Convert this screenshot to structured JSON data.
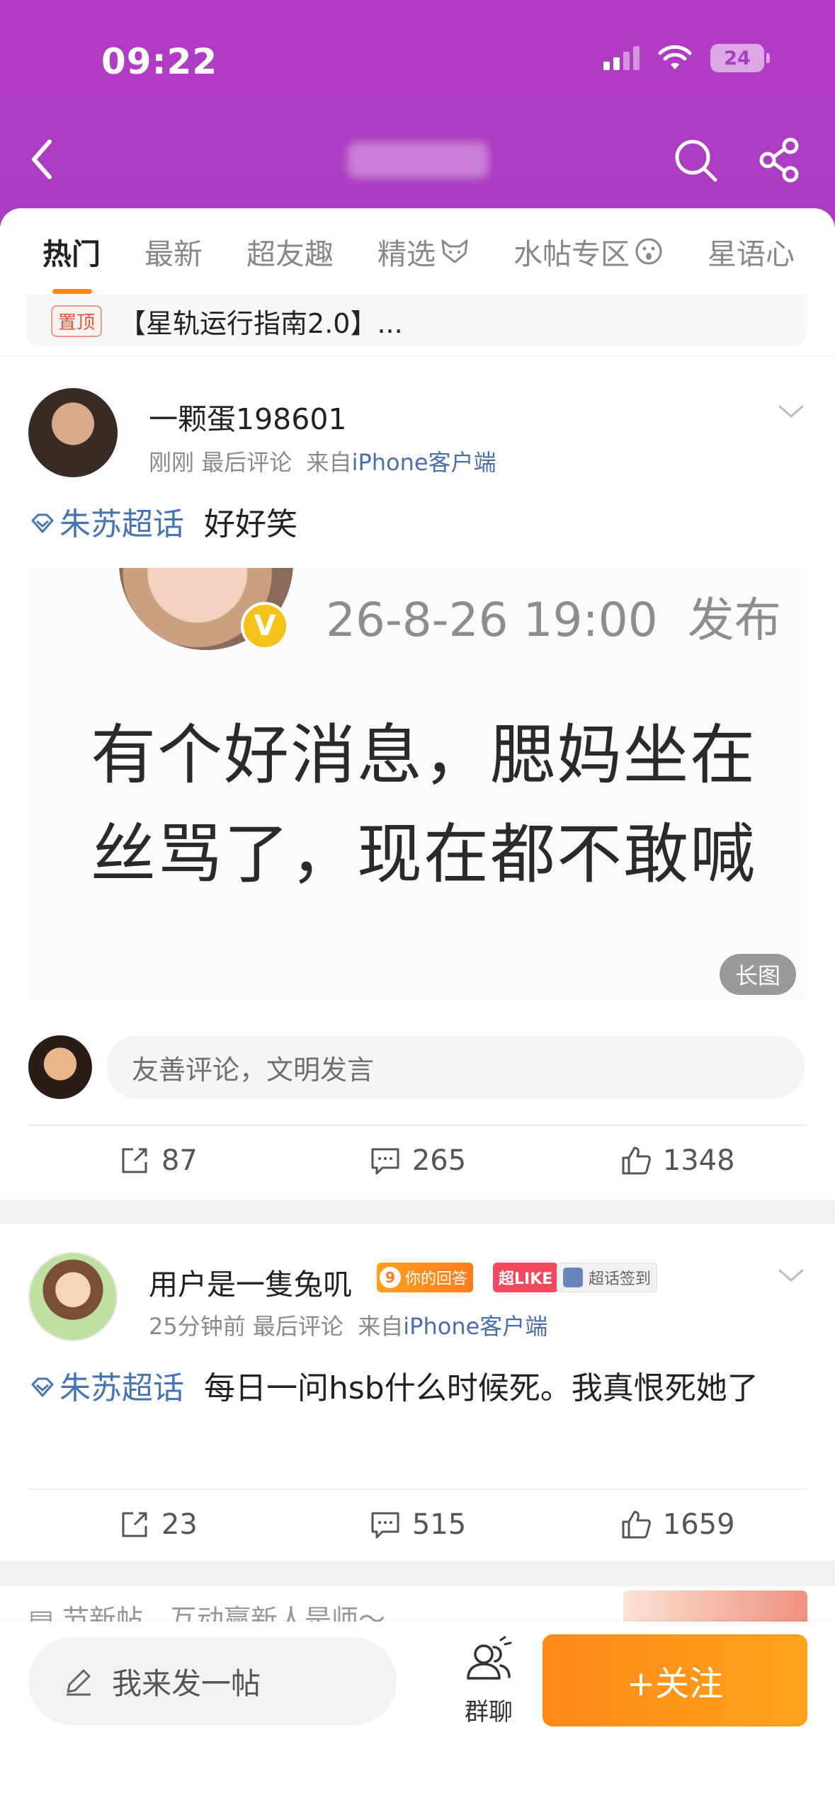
{
  "status_bar": {
    "time": "09:22",
    "battery": "24"
  },
  "tabs": [
    {
      "label": "热门",
      "active": true,
      "icon": ""
    },
    {
      "label": "最新",
      "active": false,
      "icon": ""
    },
    {
      "label": "超友趣",
      "active": false,
      "icon": ""
    },
    {
      "label": "精选",
      "active": false,
      "icon": "fox-face-icon"
    },
    {
      "label": "水帖专区",
      "active": false,
      "icon": "surprised-face-icon"
    },
    {
      "label": "星语心",
      "active": false,
      "icon": ""
    }
  ],
  "pinned": {
    "badge": "置顶",
    "text": "【星轨运行指南2.0】..."
  },
  "posts": [
    {
      "username": "一颗蛋198601",
      "time": "刚刚",
      "meta_label": "最后评论",
      "source_prefix": "来自",
      "source": "iPhone客户端",
      "topic": "朱苏超话",
      "text": "好好笑",
      "image": {
        "date": "26-8-26 19:00",
        "publish": "发布",
        "line1": "有个好消息，腮妈坐在",
        "line2": "丝骂了，现在都不敢喊",
        "long_label": "长图"
      },
      "comment_placeholder": "友善评论，文明发言",
      "reposts": "87",
      "comments": "265",
      "likes": "1348"
    },
    {
      "username": "用户是一隻兔叽",
      "badges": {
        "answer_level": "9",
        "answer": "你的回答",
        "like": "超LIKE",
        "sign": "超话签到"
      },
      "time": "25分钟前",
      "meta_label": "最后评论",
      "source_prefix": "来自",
      "source": "iPhone客户端",
      "topic": "朱苏超话",
      "text": "每日一问hsb什么时候死。我真恨死她了",
      "reposts": "23",
      "comments": "515",
      "likes": "1659"
    }
  ],
  "peek": {
    "text": "▤ 节新帖，互动赢新人是师～"
  },
  "bottom_bar": {
    "write_label": "我来发一帖",
    "group_label": "群聊",
    "follow_label": "+关注"
  },
  "colors": {
    "header": "#a93cc0",
    "accent": "#f28a1f",
    "topic": "#4774b2",
    "follow": "#ff8a1a"
  }
}
